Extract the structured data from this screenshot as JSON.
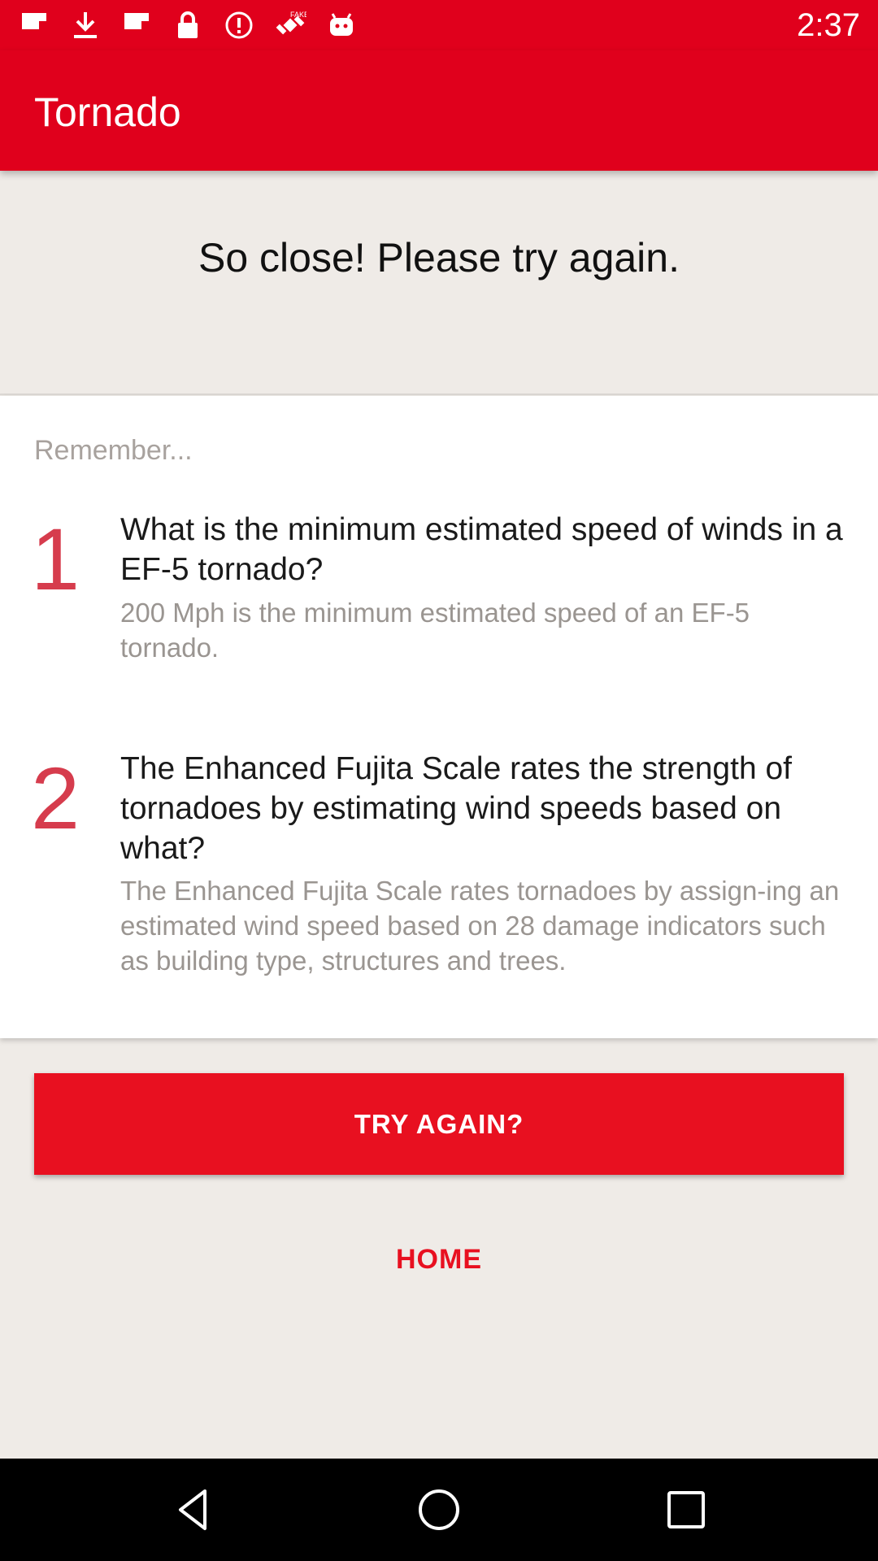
{
  "status_bar": {
    "time": "2:37",
    "icons": [
      "flipboard-icon",
      "download-icon",
      "flipboard-icon",
      "lock-icon",
      "alert-circle-icon",
      "satellite-fake-gps-icon",
      "android-icon"
    ]
  },
  "app_bar": {
    "title": "Tornado"
  },
  "result": {
    "message": "So close! Please try again."
  },
  "review": {
    "heading": "Remember...",
    "items": [
      {
        "number": "1",
        "question": "What is the minimum estimated speed of winds in a EF-5 tornado?",
        "answer": "200 Mph is the minimum estimated speed of an EF-5 tornado."
      },
      {
        "number": "2",
        "question": "The Enhanced Fujita Scale rates the strength of tornadoes by estimating wind speeds based on what?",
        "answer": "The Enhanced Fujita Scale rates tornadoes by assign-ing an estimated wind speed based on 28 damage indicators such as building type, structures and trees."
      }
    ]
  },
  "actions": {
    "try_again_label": "TRY AGAIN?",
    "home_label": "HOME"
  },
  "nav_bar": {
    "buttons": [
      "back-icon",
      "home-icon",
      "recents-icon"
    ]
  },
  "colors": {
    "accent": "#e0001c",
    "number": "#d63c4d",
    "background": "#efebe7"
  }
}
